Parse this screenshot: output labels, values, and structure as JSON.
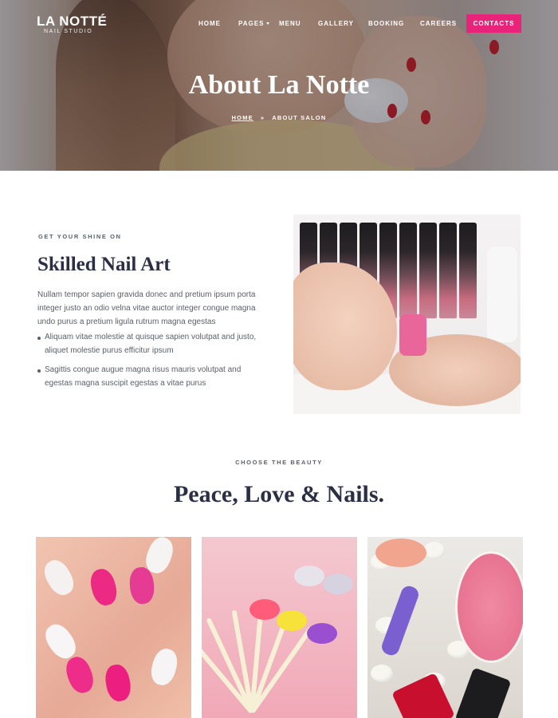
{
  "header": {
    "logo": {
      "title": "LA NOTTÉ",
      "subtitle": "NAIL STUDIO"
    },
    "nav": [
      {
        "label": "HOME"
      },
      {
        "label": "PAGES"
      },
      {
        "label": "MENU"
      },
      {
        "label": "GALLERY"
      },
      {
        "label": "BOOKING"
      },
      {
        "label": "CAREERS"
      }
    ],
    "cta_label": "CONTACTS",
    "accent_color": "#e9237a"
  },
  "hero": {
    "title": "About La Notte",
    "breadcrumb": {
      "home": "HOME",
      "separator": "»",
      "current": "ABOUT SALON"
    }
  },
  "about": {
    "eyebrow": "GET YOUR SHINE ON",
    "title": "Skilled Nail Art",
    "text": "Nullam tempor sapien gravida donec and pretium ipsum porta integer justo an odio velna vitae auctor integer congue magna undo purus a pretium ligula rutrum magna egestas",
    "bullets": [
      "Aliquam vitae molestie at quisque sapien volutpat and justo, aliquet molestie purus efficitur ipsum",
      "Sagittis congue augue magna risus mauris volutpat and egestas magna suscipit egestas a vitae purus"
    ]
  },
  "beauty": {
    "eyebrow": "CHOOSE THE BEAUTY",
    "title": "Peace, Love & Nails."
  }
}
